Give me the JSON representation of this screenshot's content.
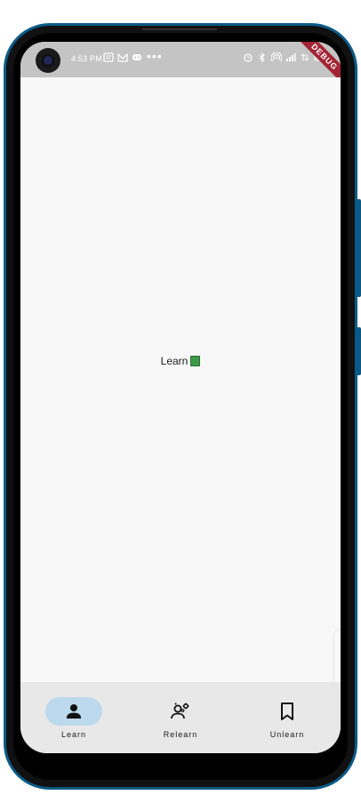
{
  "status_bar": {
    "time": "4:53 PM",
    "more_dots": "•••",
    "left_icons": [
      "message-icon",
      "mail-icon",
      "game-icon"
    ],
    "right_icons": [
      "alarm-icon",
      "bluetooth-icon",
      "hotspot-icon",
      "signal-icon",
      "data-icon",
      "battery-icon"
    ]
  },
  "debug_banner": "DEBUG",
  "main": {
    "center_text": "Learn"
  },
  "bottom_nav": {
    "items": [
      {
        "label": "Learn",
        "icon": "person-icon",
        "active": true
      },
      {
        "label": "Relearn",
        "icon": "person-gears-icon",
        "active": false
      },
      {
        "label": "Unlearn",
        "icon": "bookmark-icon",
        "active": false
      }
    ]
  },
  "colors": {
    "status_bar_bg": "#c4c4c4",
    "screen_bg": "#f8f8f8",
    "nav_bg": "#e8e8e8",
    "active_pill": "#bcd9ee",
    "debug_banner": "#a32434",
    "device_frame": "#0a5a86"
  }
}
